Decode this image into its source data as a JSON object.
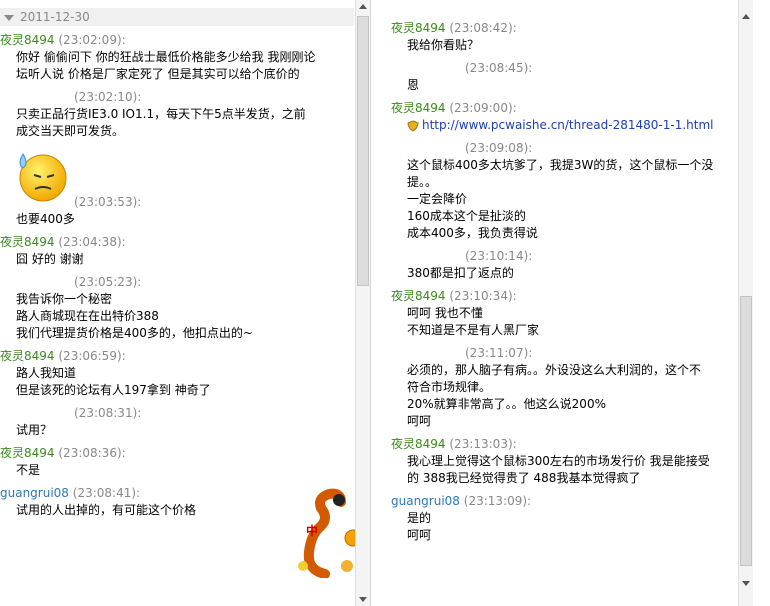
{
  "left": {
    "date_divider": "2011-12-30",
    "messages": [
      {
        "sender": "夜灵8494",
        "time": "(23:02:09):",
        "lines": [
          "你好 偷偷问下 你的狂战士最低价格能多少给我 我刚刚论",
          "坛听人说 价格是厂家定死了 但是其实可以给个底价的"
        ]
      },
      {
        "sender": "",
        "time": "(23:02:10):",
        "lines": [
          "只卖正品行货IE3.0 IO1.1，每天下午5点半发货，之前",
          "成交当天即可发货。"
        ],
        "emoji": "sweat-face-emoji"
      },
      {
        "sender": "",
        "time": "(23:03:53):",
        "lines": [
          "也要400多"
        ]
      },
      {
        "sender": "夜灵8494",
        "time": "(23:04:38):",
        "lines": [
          "囧 好的 谢谢"
        ]
      },
      {
        "sender": "",
        "time": "(23:05:23):",
        "lines": [
          "我告诉你一个秘密",
          "路人商城现在在出特价388",
          "我们代理提货价格是400多的，他扣点出的~"
        ]
      },
      {
        "sender": "夜灵8494",
        "time": "(23:06:59):",
        "lines": [
          "路人我知道",
          "但是该死的论坛有人197拿到 神奇了"
        ]
      },
      {
        "sender": "",
        "time": "(23:08:31):",
        "lines": [
          "试用？"
        ]
      },
      {
        "sender": "夜灵8494",
        "time": "(23:08:36):",
        "lines": [
          "不是"
        ]
      },
      {
        "sender": "guangrui08",
        "time": "(23:08:41):",
        "lines": [
          "试用的人出掉的，有可能这个价格"
        ]
      }
    ],
    "badge_text": "中"
  },
  "right": {
    "messages": [
      {
        "sender": "夜灵8494",
        "time": "(23:08:42):",
        "lines": [
          "我给你看贴？"
        ]
      },
      {
        "sender": "",
        "time": "(23:08:45):",
        "lines": [
          "恩"
        ]
      },
      {
        "sender": "夜灵8494",
        "time": "(23:09:00):",
        "lines": [
          "http://www.pcwaishe.cn/thread-281480-1-1.html"
        ],
        "link": true
      },
      {
        "sender": "",
        "time": "(23:09:08):",
        "lines": [
          "这个鼠标400多太坑爹了，我提3W的货，这个鼠标一个没",
          "提。。",
          "一定会降价",
          "160成本这个是扯淡的",
          "成本400多，我负责得说"
        ]
      },
      {
        "sender": "",
        "time": "(23:10:14):",
        "lines": [
          "380都是扣了返点的"
        ]
      },
      {
        "sender": "夜灵8494",
        "time": "(23:10:34):",
        "lines": [
          "呵呵 我也不懂",
          "不知道是不是有人黑厂家"
        ]
      },
      {
        "sender": "",
        "time": "(23:11:07):",
        "lines": [
          "必须的，那人脑子有病。。外设没这么大利润的，这个不",
          "符合市场规律。",
          "20%就算非常高了。。他这么说200%",
          "呵呵"
        ]
      },
      {
        "sender": "夜灵8494",
        "time": "(23:13:03):",
        "lines": [
          "我心理上觉得这个鼠标300左右的市场发行价 我是能接受",
          "的 388我已经觉得贵了 488我基本觉得疯了"
        ]
      },
      {
        "sender": "guangrui08",
        "time": "(23:13:09):",
        "lines": [
          "是的",
          "呵呵"
        ]
      }
    ]
  },
  "colors": {
    "nick_green": "#3b8a1e",
    "nick_blue": "#2a7ab8",
    "time_gray": "#888888",
    "link_blue": "#1a3fb0"
  }
}
